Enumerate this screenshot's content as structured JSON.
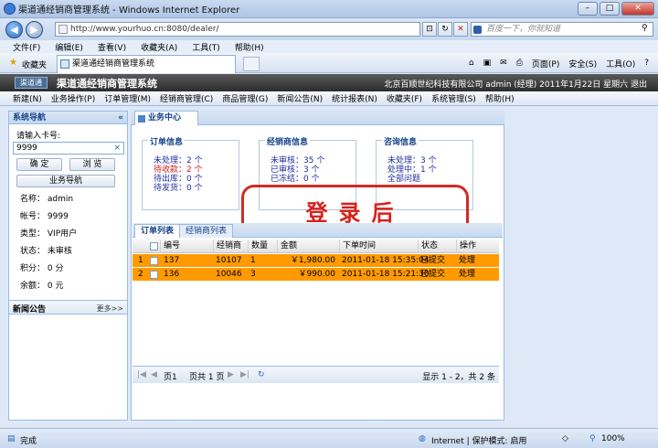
{
  "browser": {
    "window_title": "渠道通经销商管理系统 - Windows Internet Explorer",
    "url": "http://www.yourhuo.cn:8080/dealer/",
    "search_placeholder": "百度一下，你就知道",
    "menu": [
      "文件(F)",
      "编辑(E)",
      "查看(V)",
      "收藏夹(A)",
      "工具(T)",
      "帮助(H)"
    ],
    "favorites_label": "收藏夹",
    "tab_title": "渠道通经销商管理系统",
    "tools": [
      "页面(P)",
      "安全(S)",
      "工具(O)"
    ],
    "status_left": "完成",
    "status_zone": "Internet | 保护模式: 启用",
    "zoom": "100%"
  },
  "app": {
    "logo": "渠道通",
    "title": "渠道通经销商管理系统",
    "info": "北京百顺世纪科技有限公司    admin (经理)    2011年1月22日 星期六    退出",
    "menu": [
      "新建(N)",
      "业务操作(P)",
      "订单管理(M)",
      "经销商管理(C)",
      "商品管理(G)",
      "新闻公告(N)",
      "统计报表(N)",
      "收藏夹(F)",
      "系统管理(S)",
      "帮助(H)"
    ]
  },
  "sidebar": {
    "title": "系统导航",
    "collapse": "«",
    "card_label": "请输入卡号:",
    "card_value": "9999",
    "clear": "×",
    "confirm": "确 定",
    "browse": "浏 览",
    "nav": "业务导航",
    "fields": [
      {
        "label": "名称：",
        "value": "admin"
      },
      {
        "label": "帐号：",
        "value": "9999"
      },
      {
        "label": "类型：",
        "value": "VIP用户"
      },
      {
        "label": "状态：",
        "value": "未审核"
      },
      {
        "label": "积分：",
        "value": "0  分"
      },
      {
        "label": "余额：",
        "value": "0  元"
      }
    ],
    "news_title": "新闻公告",
    "news_more": "更多>>"
  },
  "main": {
    "tab": "业务中心",
    "order_info": {
      "title": "订单信息",
      "lines": [
        "未处理：2 个",
        "待收款：2 个",
        "待出库：0 个",
        "待发货：0 个"
      ]
    },
    "dealer_info": {
      "title": "经销商信息",
      "lines": [
        "未审核：35 个",
        "已审核：3 个",
        "已冻结：0 个"
      ]
    },
    "consult_info": {
      "title": "咨询信息",
      "lines": [
        "未处理：3 个",
        "处理中：1 个",
        "全部问题"
      ]
    },
    "stamp": "登录后",
    "grid_tabs": [
      "订单列表",
      "经销商列表"
    ],
    "columns": [
      "编号",
      "经销商",
      "数量",
      "金额",
      "下单时间",
      "状态",
      "操作"
    ],
    "rows": [
      {
        "n": "1",
        "id": "137",
        "dealer": "10107",
        "qty": "1",
        "amount": "￥1,980.00",
        "time": "2011-01-18 15:35:04",
        "status": "已提交",
        "op": "处理"
      },
      {
        "n": "2",
        "id": "136",
        "dealer": "10046",
        "qty": "3",
        "amount": "￥990.00",
        "time": "2011-01-18 15:21:30",
        "status": "已提交",
        "op": "处理"
      }
    ],
    "pager_page": "页1",
    "pager_total": "页共 1 页",
    "pager_display": "显示 1 - 2，共 2 条"
  },
  "colors": {
    "row_highlight": "#ff9a00",
    "stamp": "#d22a24",
    "header": "#2c2c2c"
  }
}
